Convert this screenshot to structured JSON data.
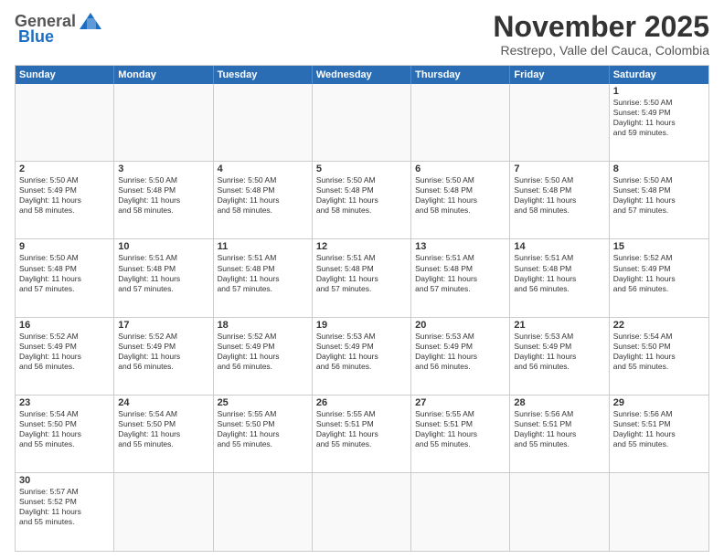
{
  "header": {
    "logo_general": "General",
    "logo_blue": "Blue",
    "month": "November 2025",
    "location": "Restrepo, Valle del Cauca, Colombia"
  },
  "weekdays": [
    "Sunday",
    "Monday",
    "Tuesday",
    "Wednesday",
    "Thursday",
    "Friday",
    "Saturday"
  ],
  "rows": [
    [
      {
        "day": "",
        "info": ""
      },
      {
        "day": "",
        "info": ""
      },
      {
        "day": "",
        "info": ""
      },
      {
        "day": "",
        "info": ""
      },
      {
        "day": "",
        "info": ""
      },
      {
        "day": "",
        "info": ""
      },
      {
        "day": "1",
        "info": "Sunrise: 5:50 AM\nSunset: 5:49 PM\nDaylight: 11 hours\nand 59 minutes."
      }
    ],
    [
      {
        "day": "2",
        "info": "Sunrise: 5:50 AM\nSunset: 5:49 PM\nDaylight: 11 hours\nand 58 minutes."
      },
      {
        "day": "3",
        "info": "Sunrise: 5:50 AM\nSunset: 5:48 PM\nDaylight: 11 hours\nand 58 minutes."
      },
      {
        "day": "4",
        "info": "Sunrise: 5:50 AM\nSunset: 5:48 PM\nDaylight: 11 hours\nand 58 minutes."
      },
      {
        "day": "5",
        "info": "Sunrise: 5:50 AM\nSunset: 5:48 PM\nDaylight: 11 hours\nand 58 minutes."
      },
      {
        "day": "6",
        "info": "Sunrise: 5:50 AM\nSunset: 5:48 PM\nDaylight: 11 hours\nand 58 minutes."
      },
      {
        "day": "7",
        "info": "Sunrise: 5:50 AM\nSunset: 5:48 PM\nDaylight: 11 hours\nand 58 minutes."
      },
      {
        "day": "8",
        "info": "Sunrise: 5:50 AM\nSunset: 5:48 PM\nDaylight: 11 hours\nand 57 minutes."
      }
    ],
    [
      {
        "day": "9",
        "info": "Sunrise: 5:50 AM\nSunset: 5:48 PM\nDaylight: 11 hours\nand 57 minutes."
      },
      {
        "day": "10",
        "info": "Sunrise: 5:51 AM\nSunset: 5:48 PM\nDaylight: 11 hours\nand 57 minutes."
      },
      {
        "day": "11",
        "info": "Sunrise: 5:51 AM\nSunset: 5:48 PM\nDaylight: 11 hours\nand 57 minutes."
      },
      {
        "day": "12",
        "info": "Sunrise: 5:51 AM\nSunset: 5:48 PM\nDaylight: 11 hours\nand 57 minutes."
      },
      {
        "day": "13",
        "info": "Sunrise: 5:51 AM\nSunset: 5:48 PM\nDaylight: 11 hours\nand 57 minutes."
      },
      {
        "day": "14",
        "info": "Sunrise: 5:51 AM\nSunset: 5:48 PM\nDaylight: 11 hours\nand 56 minutes."
      },
      {
        "day": "15",
        "info": "Sunrise: 5:52 AM\nSunset: 5:49 PM\nDaylight: 11 hours\nand 56 minutes."
      }
    ],
    [
      {
        "day": "16",
        "info": "Sunrise: 5:52 AM\nSunset: 5:49 PM\nDaylight: 11 hours\nand 56 minutes."
      },
      {
        "day": "17",
        "info": "Sunrise: 5:52 AM\nSunset: 5:49 PM\nDaylight: 11 hours\nand 56 minutes."
      },
      {
        "day": "18",
        "info": "Sunrise: 5:52 AM\nSunset: 5:49 PM\nDaylight: 11 hours\nand 56 minutes."
      },
      {
        "day": "19",
        "info": "Sunrise: 5:53 AM\nSunset: 5:49 PM\nDaylight: 11 hours\nand 56 minutes."
      },
      {
        "day": "20",
        "info": "Sunrise: 5:53 AM\nSunset: 5:49 PM\nDaylight: 11 hours\nand 56 minutes."
      },
      {
        "day": "21",
        "info": "Sunrise: 5:53 AM\nSunset: 5:49 PM\nDaylight: 11 hours\nand 56 minutes."
      },
      {
        "day": "22",
        "info": "Sunrise: 5:54 AM\nSunset: 5:50 PM\nDaylight: 11 hours\nand 55 minutes."
      }
    ],
    [
      {
        "day": "23",
        "info": "Sunrise: 5:54 AM\nSunset: 5:50 PM\nDaylight: 11 hours\nand 55 minutes."
      },
      {
        "day": "24",
        "info": "Sunrise: 5:54 AM\nSunset: 5:50 PM\nDaylight: 11 hours\nand 55 minutes."
      },
      {
        "day": "25",
        "info": "Sunrise: 5:55 AM\nSunset: 5:50 PM\nDaylight: 11 hours\nand 55 minutes."
      },
      {
        "day": "26",
        "info": "Sunrise: 5:55 AM\nSunset: 5:51 PM\nDaylight: 11 hours\nand 55 minutes."
      },
      {
        "day": "27",
        "info": "Sunrise: 5:55 AM\nSunset: 5:51 PM\nDaylight: 11 hours\nand 55 minutes."
      },
      {
        "day": "28",
        "info": "Sunrise: 5:56 AM\nSunset: 5:51 PM\nDaylight: 11 hours\nand 55 minutes."
      },
      {
        "day": "29",
        "info": "Sunrise: 5:56 AM\nSunset: 5:51 PM\nDaylight: 11 hours\nand 55 minutes."
      }
    ],
    [
      {
        "day": "30",
        "info": "Sunrise: 5:57 AM\nSunset: 5:52 PM\nDaylight: 11 hours\nand 55 minutes."
      },
      {
        "day": "",
        "info": ""
      },
      {
        "day": "",
        "info": ""
      },
      {
        "day": "",
        "info": ""
      },
      {
        "day": "",
        "info": ""
      },
      {
        "day": "",
        "info": ""
      },
      {
        "day": "",
        "info": ""
      }
    ]
  ]
}
